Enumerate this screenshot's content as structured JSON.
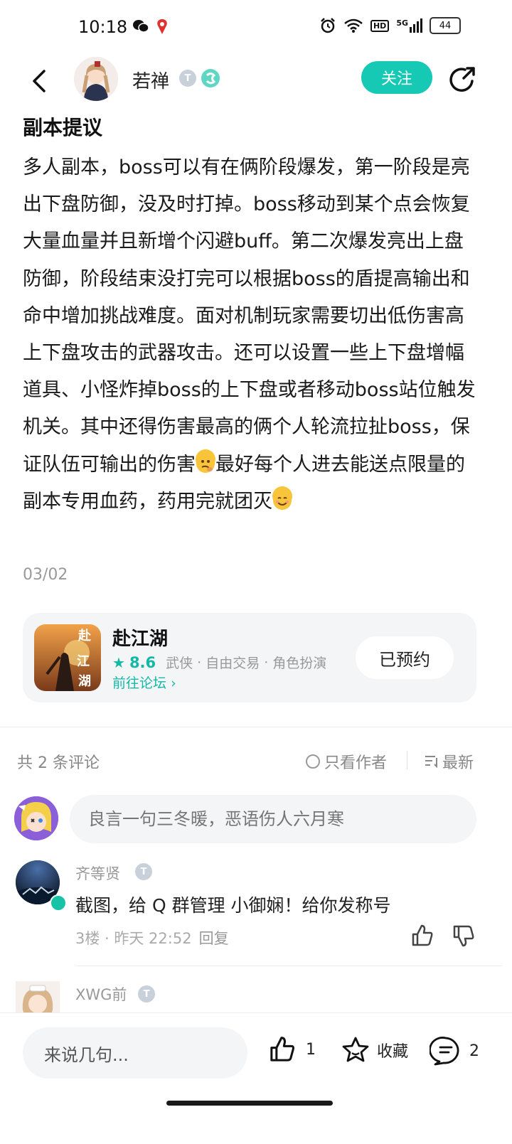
{
  "status_bar": {
    "time": "10:18",
    "network": "5G",
    "battery": "44",
    "hd": "HD"
  },
  "header": {
    "username": "若禅",
    "level_badge": "T",
    "follow_label": "关注"
  },
  "post": {
    "title": "副本提议",
    "body_parts": [
      "多人副本，boss可以有在俩阶段爆发，第一阶段是亮出下盘防御，没及时打掉。boss移动到某个点会恢复大量血量并且新增个闪避buff。第二次爆发亮出上盘防御，阶段结束没打完可以根据boss的盾提高输出和命中增加挑战难度。面对机制玩家需要切出低伤害高上下盘攻击的武器攻击。还可以设置一些上下盘增幅道具、小怪炸掉boss的上下盘或者移动boss站位触发机关。其中还得伤害最高的俩个人轮流拉扯boss，保证队伍可输出的伤害",
      "最好每个人进去能送点限量的副本专用血药，药用完就团灭"
    ],
    "emoji_1": "thinking-face-emoji",
    "emoji_2": "smiling-face-emoji",
    "date": "03/02"
  },
  "game_card": {
    "name": "赴江湖",
    "icon_text": "赴江湖",
    "rating": "8.6",
    "tags": [
      "武侠",
      "自由交易",
      "角色扮演"
    ],
    "forum_link": "前往论坛",
    "reserved_label": "已预约"
  },
  "comments_header": {
    "count_label": "共 2 条评论",
    "author_only": "只看作者",
    "sort_label": "最新"
  },
  "comment_input": {
    "placeholder": "良言一句三冬暖，恶语伤人六月寒"
  },
  "comments": [
    {
      "username": "齐等贤",
      "badge": "T",
      "text": "截图，给 Q 群管理 小御娴！给你发称号",
      "meta": "3楼 · 昨天 22:52",
      "reply": "回复"
    },
    {
      "username": "XWG前",
      "badge": "T"
    }
  ],
  "bottom_bar": {
    "input_placeholder": "来说几句...",
    "like_count": "1",
    "favorite_label": "收藏",
    "comment_count": "2"
  },
  "colors": {
    "accent": "#15c9b5",
    "rating": "#15b8a6",
    "muted": "#999999"
  }
}
